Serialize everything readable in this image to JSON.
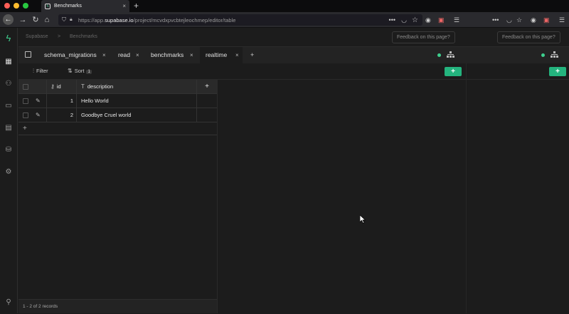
{
  "browser": {
    "tab_title": "Benchmarks",
    "url_prefix": "https://app.",
    "url_host": "supabase.io",
    "url_path": "/project/mcvdxpvcbtejleochmep/editor/table"
  },
  "header": {
    "crumb_org": "Supabase",
    "crumb_separator": ">",
    "crumb_project": "Benchmarks",
    "feedback_label": "Feedback on this page?"
  },
  "tabs": [
    {
      "label": "schema_migrations"
    },
    {
      "label": "read"
    },
    {
      "label": "benchmarks"
    },
    {
      "label": "realtime"
    }
  ],
  "tab_close": "×",
  "tab_add": "+",
  "toolbar": {
    "filter_label": "Filter",
    "sort_label": "Sort",
    "sort_count": "1",
    "add_label": "+"
  },
  "grid": {
    "columns": [
      {
        "label": "id"
      },
      {
        "label": "description"
      }
    ],
    "add_column": "+",
    "rows": [
      {
        "id": "1",
        "description": "Hello World"
      },
      {
        "id": "2",
        "description": "Goodbye Cruel world"
      }
    ],
    "add_row": "+",
    "footer": "1 - 2 of 2 records"
  },
  "colors": {
    "accent": "#3ecf8e",
    "button": "#24b47e",
    "background": "#1c1c1c"
  }
}
